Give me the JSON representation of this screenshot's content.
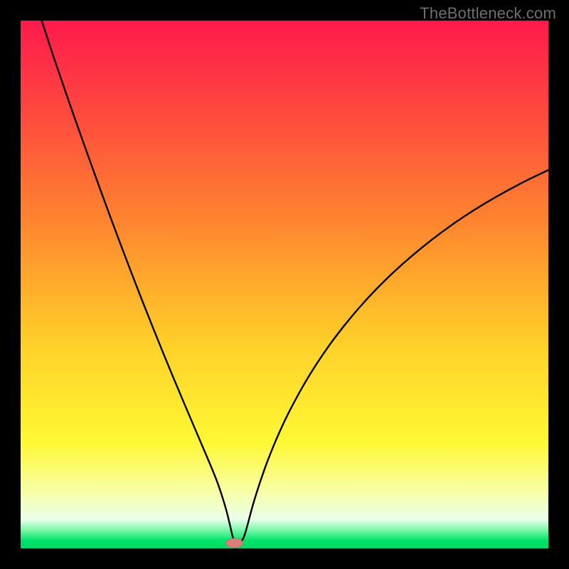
{
  "watermark": "TheBottleneck.com",
  "colors": {
    "frame_border": "#000000",
    "curve": "#000000",
    "marker_fill": "#d77f7b",
    "marker_stroke": "#c96863",
    "gradient_stops": [
      {
        "offset": 0.0,
        "color": "#ff1a4c"
      },
      {
        "offset": 0.18,
        "color": "#ff4a3e"
      },
      {
        "offset": 0.4,
        "color": "#ff8b2e"
      },
      {
        "offset": 0.62,
        "color": "#ffd229"
      },
      {
        "offset": 0.8,
        "color": "#fff835"
      },
      {
        "offset": 0.9,
        "color": "#f6ffb0"
      },
      {
        "offset": 0.945,
        "color": "#eaffea"
      },
      {
        "offset": 0.965,
        "color": "#7cf7a8"
      },
      {
        "offset": 0.985,
        "color": "#00e46b"
      },
      {
        "offset": 1.0,
        "color": "#00d862"
      }
    ]
  },
  "chart_data": {
    "type": "line",
    "title": "",
    "xlabel": "",
    "ylabel": "",
    "xlim": [
      0,
      100
    ],
    "ylim": [
      0,
      100
    ],
    "grid": false,
    "legend": false,
    "optimum_x": 40,
    "marker": {
      "x": 40.5,
      "y": 1.0,
      "rx": 1.6,
      "ry": 0.9
    },
    "series": [
      {
        "name": "bottleneck-curve",
        "x": [
          4.0,
          6.0,
          8.0,
          10.0,
          12.0,
          14.0,
          16.0,
          18.0,
          20.0,
          22.0,
          24.0,
          26.0,
          28.0,
          30.0,
          32.0,
          34.0,
          35.5,
          37.0,
          38.0,
          39.0,
          39.7,
          40.3,
          41.0,
          41.6,
          42.3,
          43.0,
          44.0,
          45.5,
          47.0,
          49.0,
          51.0,
          54.0,
          57.0,
          60.0,
          64.0,
          68.0,
          72.0,
          76.0,
          80.0,
          84.0,
          88.0,
          92.0,
          96.0,
          100.0
        ],
        "y": [
          100.0,
          93.8,
          88.0,
          82.2,
          76.6,
          71.0,
          65.5,
          60.1,
          54.8,
          49.6,
          44.5,
          39.5,
          34.6,
          29.8,
          25.1,
          20.4,
          16.9,
          13.3,
          10.5,
          7.2,
          4.3,
          1.6,
          1.0,
          1.0,
          2.0,
          4.4,
          8.3,
          13.0,
          17.2,
          22.0,
          26.2,
          31.7,
          36.4,
          40.6,
          45.5,
          49.8,
          53.6,
          57.0,
          60.1,
          62.9,
          65.4,
          67.7,
          69.8,
          71.7
        ]
      }
    ]
  }
}
